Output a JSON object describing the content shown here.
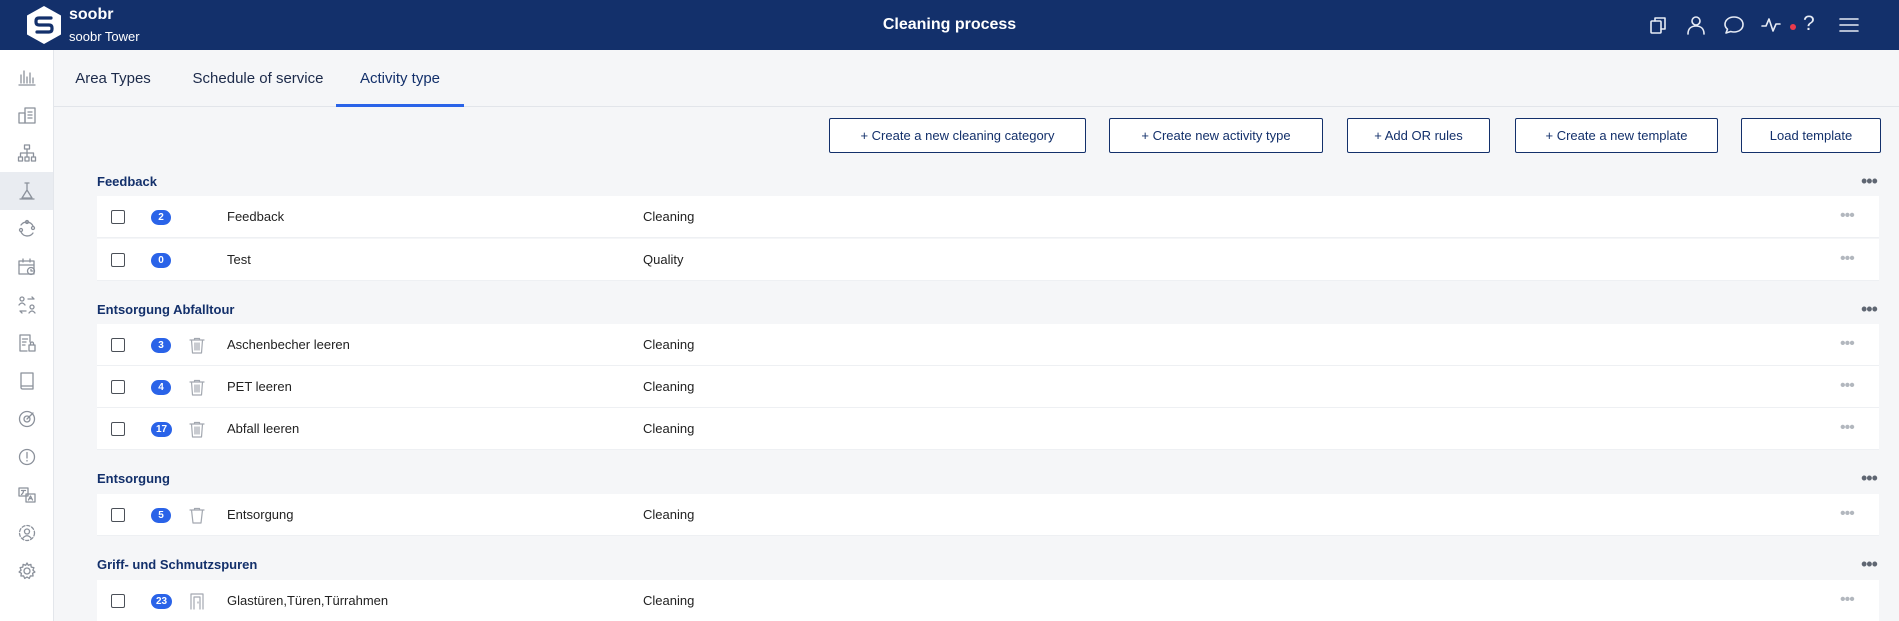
{
  "header": {
    "brand": "soobr",
    "building": "soobr Tower",
    "title": "Cleaning process",
    "icons": [
      "copy-icon",
      "user-icon",
      "chat-icon",
      "activity-icon",
      "help-icon",
      "menu-icon"
    ],
    "help_glyph": "?",
    "notification_color": "#ea3a4c"
  },
  "sidebar": {
    "items": [
      "chart-icon",
      "dashboard-icon",
      "hierarchy-icon",
      "cleaning-process-icon",
      "cycle-icon",
      "calendar-icon",
      "transfer-icon",
      "report-icon",
      "book-icon",
      "target-icon",
      "alert-icon",
      "language-icon",
      "users-settings-icon",
      "gear-icon"
    ],
    "active_index": 3
  },
  "tabs": [
    {
      "label": "Area Types"
    },
    {
      "label": "Schedule of service"
    },
    {
      "label": "Activity type",
      "active": true
    }
  ],
  "actions": {
    "create_category": "+ Create a new cleaning category",
    "create_activity": "+ Create new activity type",
    "add_or_rules": "+ Add OR rules",
    "create_template": "+ Create a new template",
    "load_template": "Load template"
  },
  "sections": [
    {
      "title": "Feedback",
      "rows": [
        {
          "count": "2",
          "icon": null,
          "name": "Feedback",
          "type": "Cleaning"
        },
        {
          "count": "0",
          "icon": null,
          "name": "Test",
          "type": "Quality"
        }
      ]
    },
    {
      "title": "Entsorgung Abfalltour",
      "rows": [
        {
          "count": "3",
          "icon": "waste-bin-icon",
          "name": "Aschenbecher leeren",
          "type": "Cleaning"
        },
        {
          "count": "4",
          "icon": "waste-bin-icon",
          "name": "PET leeren",
          "type": "Cleaning"
        },
        {
          "count": "17",
          "icon": "waste-bin-icon",
          "name": "Abfall leeren",
          "type": "Cleaning"
        }
      ]
    },
    {
      "title": "Entsorgung",
      "rows": [
        {
          "count": "5",
          "icon": "trash-can-icon",
          "name": "Entsorgung",
          "type": "Cleaning"
        }
      ]
    },
    {
      "title": "Griff- und Schmutzspuren",
      "rows": [
        {
          "count": "23",
          "icon": "door-icon",
          "name": "Glastüren,Türen,Türrahmen",
          "type": "Cleaning"
        }
      ]
    }
  ],
  "colors": {
    "header_bg": "#13306b",
    "accent": "#2a63e8",
    "badge": "#2a63e8"
  }
}
